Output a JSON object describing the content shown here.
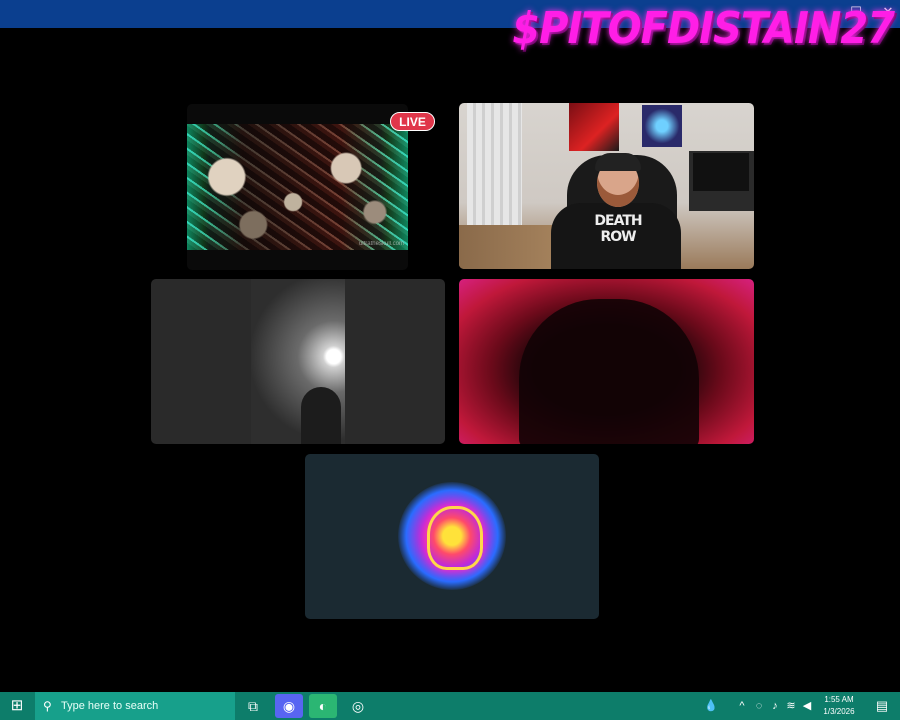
{
  "window": {
    "brand_text": "$PITOFDISTAIN27",
    "controls": {
      "maximize_glyph": "☐",
      "close_glyph": "✕"
    }
  },
  "tiles": [
    {
      "name": "stream-tile-live",
      "badge": "LIVE",
      "watermark": "ultratheskull.com"
    },
    {
      "name": "webcam-tile-room",
      "shirt_text": "DEATH ROW"
    },
    {
      "name": "webcam-tile-dark"
    },
    {
      "name": "webcam-tile-red"
    },
    {
      "name": "avatar-tile-skull"
    }
  ],
  "taskbar": {
    "start_glyph": "⊞",
    "search_placeholder": "Type here to search",
    "search_glyph": "⚲",
    "apps": [
      {
        "name": "task-view",
        "glyph": "⧉"
      },
      {
        "name": "discord",
        "glyph": "◉"
      },
      {
        "name": "edge",
        "glyph": "◐"
      },
      {
        "name": "obs",
        "glyph": "◎"
      }
    ],
    "tray": {
      "weather_glyph": "💧",
      "chevron_glyph": "^",
      "clock_time": "1:55 AM",
      "clock_date": "1/3/2026",
      "notif_glyph": "▤"
    }
  },
  "colors": {
    "accent_brand": "#ff1ee6",
    "live_badge": "#e0364a",
    "taskbar": "#0d7d6a"
  }
}
